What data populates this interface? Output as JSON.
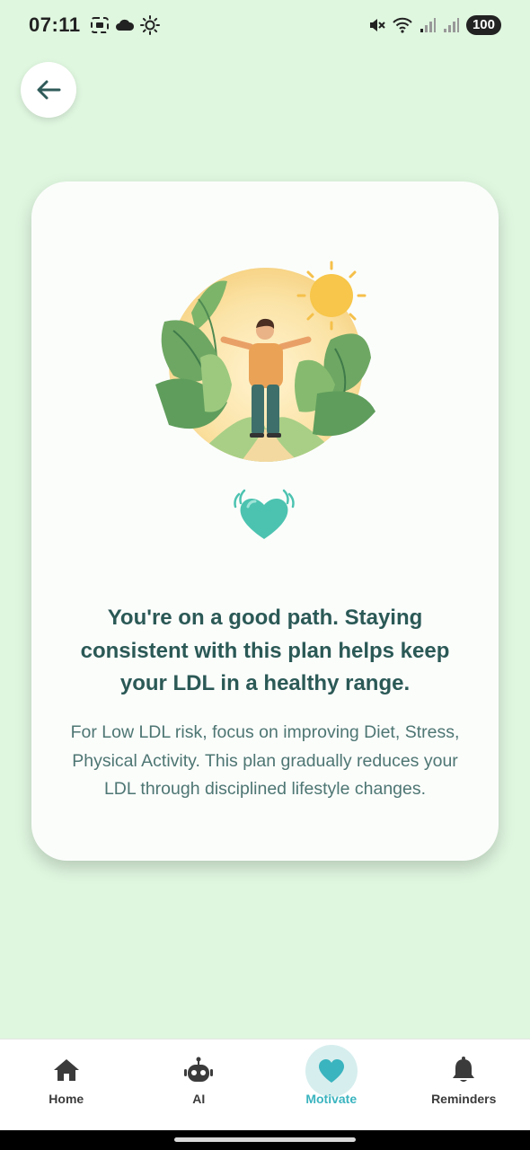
{
  "status_bar": {
    "time": "07:11",
    "battery": "100",
    "left_icons": [
      "screenshot-icon",
      "cloud-icon",
      "sun-icon"
    ],
    "right_icons": [
      "mute-icon",
      "wifi-icon",
      "signal-icon",
      "signal-icon"
    ]
  },
  "back_button": {
    "icon": "arrow-left-icon"
  },
  "card": {
    "illustration": "person-nature-illustration",
    "heart": "heart-icon",
    "headline": "You're on a good path. Staying consistent with this plan helps keep your LDL in a healthy range.",
    "body": "For Low LDL risk, focus on improving Diet, Stress, Physical Activity. This plan gradually reduces your LDL through disciplined lifestyle changes."
  },
  "nav": {
    "items": [
      {
        "label": "Home",
        "icon": "home-icon",
        "active": false
      },
      {
        "label": "AI",
        "icon": "robot-icon",
        "active": false
      },
      {
        "label": "Motivate",
        "icon": "heart-icon",
        "active": true
      },
      {
        "label": "Reminders",
        "icon": "bell-icon",
        "active": false
      }
    ]
  },
  "colors": {
    "background": "#dff6df",
    "card": "#fbfdfb",
    "headline": "#2b5956",
    "accent": "#3ab4bf",
    "heart": "#4cc3b0"
  }
}
